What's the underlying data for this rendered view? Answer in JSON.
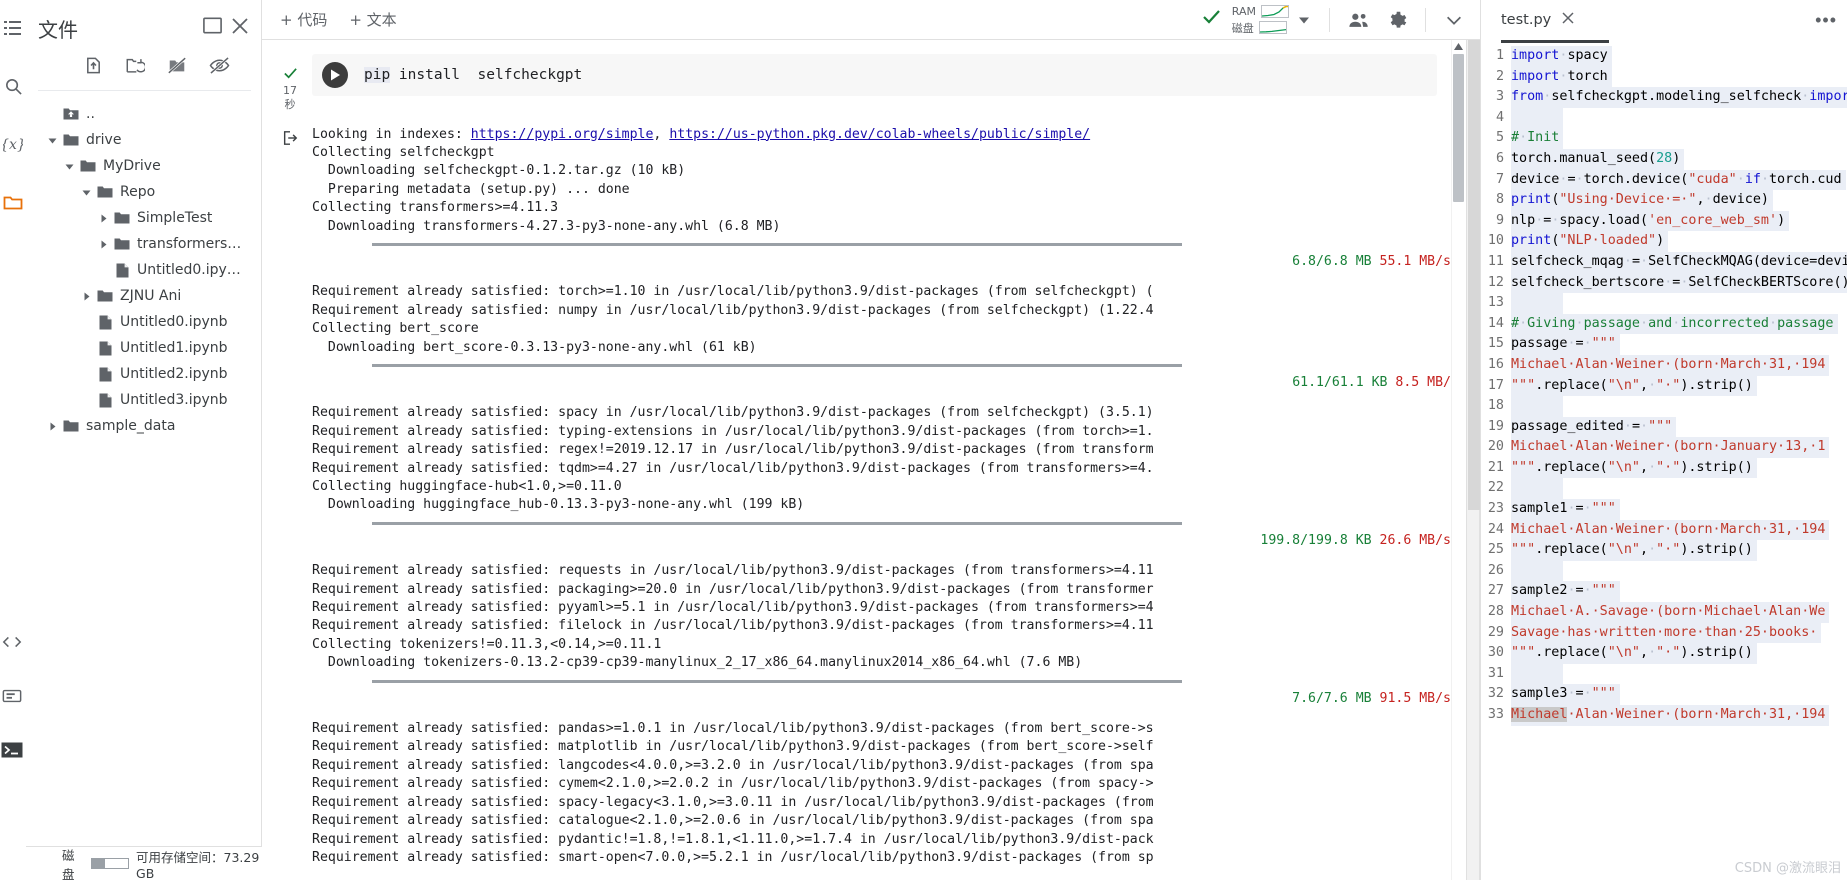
{
  "rail": {
    "top_icons": [
      "menu-icon",
      "search-icon",
      "variables-icon",
      "folder-icon"
    ],
    "bottom_icons": [
      "code-snippets-icon",
      "command-palette-icon",
      "terminal-icon"
    ]
  },
  "files": {
    "title": "文件",
    "header_icons": [
      "open-in-new-icon",
      "close-icon"
    ],
    "toolbar_icons": [
      "upload-icon",
      "refresh-folder-icon",
      "mount-drive-off-icon",
      "hide-hidden-icon"
    ],
    "tree": [
      {
        "label": "..",
        "depth": 0,
        "twisty": "",
        "icon": "folder-up-icon"
      },
      {
        "label": "drive",
        "depth": 0,
        "twisty": "down",
        "icon": "folder-icon"
      },
      {
        "label": "MyDrive",
        "depth": 1,
        "twisty": "down",
        "icon": "folder-icon"
      },
      {
        "label": "Repo",
        "depth": 2,
        "twisty": "down",
        "icon": "folder-icon"
      },
      {
        "label": "SimpleTest",
        "depth": 3,
        "twisty": "right",
        "icon": "folder-icon"
      },
      {
        "label": "transformers…",
        "depth": 3,
        "twisty": "right",
        "icon": "folder-icon"
      },
      {
        "label": "Untitled0.ipy…",
        "depth": 3,
        "twisty": "",
        "icon": "file-icon"
      },
      {
        "label": "ZJNU Ani",
        "depth": 2,
        "twisty": "right",
        "icon": "folder-icon"
      },
      {
        "label": "Untitled0.ipynb",
        "depth": 2,
        "twisty": "",
        "icon": "file-icon"
      },
      {
        "label": "Untitled1.ipynb",
        "depth": 2,
        "twisty": "",
        "icon": "file-icon"
      },
      {
        "label": "Untitled2.ipynb",
        "depth": 2,
        "twisty": "",
        "icon": "file-icon"
      },
      {
        "label": "Untitled3.ipynb",
        "depth": 2,
        "twisty": "",
        "icon": "file-icon"
      },
      {
        "label": "sample_data",
        "depth": 0,
        "twisty": "right",
        "icon": "folder-icon"
      }
    ],
    "disk": {
      "label": "磁盘",
      "gauge_percent": 38,
      "free_text": "可用存储空间：73.29 GB"
    }
  },
  "notebook": {
    "toolbar": {
      "add_code": "+ 代码",
      "add_text": "+ 文本",
      "connected_icon": "check-icon",
      "ram_label": "RAM",
      "disk_label": "磁盘",
      "dropdown_icon": "chevron-down-icon",
      "share_icon": "people-icon",
      "settings_icon": "gear-icon",
      "collapse_icon": "chevron-down-icon"
    },
    "cell": {
      "status_icon": "check-icon",
      "elapsed": "17",
      "elapsed_unit": "秒",
      "run_icon": "play-icon",
      "code_prefix": "pip",
      "code_rest": " install  selfcheckgpt",
      "output_icon": "output-arrow-icon"
    },
    "output_lines": [
      {
        "type": "link-line",
        "pre": "Looking in indexes: ",
        "links": [
          "https://pypi.org/simple",
          "https://us-python.pkg.dev/colab-wheels/public/simple/"
        ],
        "sep": ", "
      },
      {
        "type": "plain",
        "text": "Collecting selfcheckgpt"
      },
      {
        "type": "plain",
        "text": "  Downloading selfcheckgpt-0.1.2.tar.gz (10 kB)"
      },
      {
        "type": "plain",
        "text": "  Preparing metadata (setup.py) ... done"
      },
      {
        "type": "plain",
        "text": "Collecting transformers>=4.11.3"
      },
      {
        "type": "plain",
        "text": "  Downloading transformers-4.27.3-py3-none-any.whl (6.8 MB)"
      },
      {
        "type": "progress",
        "size_done": "6.8/6.8 MB",
        "speed": "55.1 MB/s"
      },
      {
        "type": "plain",
        "text": "Requirement already satisfied: torch>=1.10 in /usr/local/lib/python3.9/dist-packages (from selfcheckgpt) ("
      },
      {
        "type": "plain",
        "text": "Requirement already satisfied: numpy in /usr/local/lib/python3.9/dist-packages (from selfcheckgpt) (1.22.4"
      },
      {
        "type": "plain",
        "text": "Collecting bert_score"
      },
      {
        "type": "plain",
        "text": "  Downloading bert_score-0.3.13-py3-none-any.whl (61 kB)"
      },
      {
        "type": "progress",
        "size_done": "61.1/61.1 KB",
        "speed": "8.5 MB/"
      },
      {
        "type": "plain",
        "text": "Requirement already satisfied: spacy in /usr/local/lib/python3.9/dist-packages (from selfcheckgpt) (3.5.1)"
      },
      {
        "type": "plain",
        "text": "Requirement already satisfied: typing-extensions in /usr/local/lib/python3.9/dist-packages (from torch>=1."
      },
      {
        "type": "plain",
        "text": "Requirement already satisfied: regex!=2019.12.17 in /usr/local/lib/python3.9/dist-packages (from transform"
      },
      {
        "type": "plain",
        "text": "Requirement already satisfied: tqdm>=4.27 in /usr/local/lib/python3.9/dist-packages (from transformers>=4."
      },
      {
        "type": "plain",
        "text": "Collecting huggingface-hub<1.0,>=0.11.0"
      },
      {
        "type": "plain",
        "text": "  Downloading huggingface_hub-0.13.3-py3-none-any.whl (199 kB)"
      },
      {
        "type": "progress",
        "size_done": "199.8/199.8 KB",
        "speed": "26.6 MB/s"
      },
      {
        "type": "plain",
        "text": "Requirement already satisfied: requests in /usr/local/lib/python3.9/dist-packages (from transformers>=4.11"
      },
      {
        "type": "plain",
        "text": "Requirement already satisfied: packaging>=20.0 in /usr/local/lib/python3.9/dist-packages (from transformer"
      },
      {
        "type": "plain",
        "text": "Requirement already satisfied: pyyaml>=5.1 in /usr/local/lib/python3.9/dist-packages (from transformers>=4"
      },
      {
        "type": "plain",
        "text": "Requirement already satisfied: filelock in /usr/local/lib/python3.9/dist-packages (from transformers>=4.11"
      },
      {
        "type": "plain",
        "text": "Collecting tokenizers!=0.11.3,<0.14,>=0.11.1"
      },
      {
        "type": "plain",
        "text": "  Downloading tokenizers-0.13.2-cp39-cp39-manylinux_2_17_x86_64.manylinux2014_x86_64.whl (7.6 MB)"
      },
      {
        "type": "progress",
        "size_done": "7.6/7.6 MB",
        "speed": "91.5 MB/s"
      },
      {
        "type": "plain",
        "text": "Requirement already satisfied: pandas>=1.0.1 in /usr/local/lib/python3.9/dist-packages (from bert_score->s"
      },
      {
        "type": "plain",
        "text": "Requirement already satisfied: matplotlib in /usr/local/lib/python3.9/dist-packages (from bert_score->self"
      },
      {
        "type": "plain",
        "text": "Requirement already satisfied: langcodes<4.0.0,>=3.2.0 in /usr/local/lib/python3.9/dist-packages (from spa"
      },
      {
        "type": "plain",
        "text": "Requirement already satisfied: cymem<2.1.0,>=2.0.2 in /usr/local/lib/python3.9/dist-packages (from spacy->"
      },
      {
        "type": "plain",
        "text": "Requirement already satisfied: spacy-legacy<3.1.0,>=3.0.11 in /usr/local/lib/python3.9/dist-packages (from"
      },
      {
        "type": "plain",
        "text": "Requirement already satisfied: catalogue<2.1.0,>=2.0.6 in /usr/local/lib/python3.9/dist-packages (from spa"
      },
      {
        "type": "plain",
        "text": "Requirement already satisfied: pydantic!=1.8,!=1.8.1,<1.11.0,>=1.7.4 in /usr/local/lib/python3.9/dist-pack"
      },
      {
        "type": "plain",
        "text": "Requirement already satisfied: smart-open<7.0.0,>=5.2.1 in /usr/local/lib/python3.9/dist-packages (from sp"
      }
    ]
  },
  "editor": {
    "tab_name": "test.py",
    "close_icon": "close-icon",
    "more_icon": "more-options-icon",
    "lines": [
      {
        "n": 1,
        "segs": [
          {
            "t": "import",
            "c": "kw"
          },
          {
            "t": "·",
            "c": "dot"
          },
          {
            "t": "spacy",
            "c": ""
          }
        ]
      },
      {
        "n": 2,
        "segs": [
          {
            "t": "import",
            "c": "kw"
          },
          {
            "t": "·",
            "c": "dot"
          },
          {
            "t": "torch",
            "c": ""
          }
        ]
      },
      {
        "n": 3,
        "segs": [
          {
            "t": "from",
            "c": "kw"
          },
          {
            "t": "·",
            "c": "dot"
          },
          {
            "t": "selfcheckgpt.modeling_selfcheck",
            "c": ""
          },
          {
            "t": "·",
            "c": "dot"
          },
          {
            "t": "import",
            "c": "kw"
          }
        ]
      },
      {
        "n": 4,
        "segs": []
      },
      {
        "n": 5,
        "segs": [
          {
            "t": "#",
            "c": "cmt"
          },
          {
            "t": "·",
            "c": "dot"
          },
          {
            "t": "Init",
            "c": "cmt"
          }
        ]
      },
      {
        "n": 6,
        "segs": [
          {
            "t": "torch.manual_seed(",
            "c": ""
          },
          {
            "t": "28",
            "c": "num"
          },
          {
            "t": ")",
            "c": ""
          }
        ]
      },
      {
        "n": 7,
        "segs": [
          {
            "t": "device",
            "c": ""
          },
          {
            "t": "·",
            "c": "dot"
          },
          {
            "t": "=",
            "c": ""
          },
          {
            "t": "·",
            "c": "dot"
          },
          {
            "t": "torch.device(",
            "c": ""
          },
          {
            "t": "\"cuda\"",
            "c": "str"
          },
          {
            "t": "·",
            "c": "dot"
          },
          {
            "t": "if",
            "c": "kw"
          },
          {
            "t": "·",
            "c": "dot"
          },
          {
            "t": "torch.cud",
            "c": ""
          }
        ]
      },
      {
        "n": 8,
        "segs": [
          {
            "t": "print",
            "c": "kw"
          },
          {
            "t": "(",
            "c": ""
          },
          {
            "t": "\"Using·Device·=·\"",
            "c": "str"
          },
          {
            "t": ",",
            "c": ""
          },
          {
            "t": "·",
            "c": "dot"
          },
          {
            "t": "device)",
            "c": ""
          }
        ]
      },
      {
        "n": 9,
        "segs": [
          {
            "t": "nlp",
            "c": ""
          },
          {
            "t": "·",
            "c": "dot"
          },
          {
            "t": "=",
            "c": ""
          },
          {
            "t": "·",
            "c": "dot"
          },
          {
            "t": "spacy.load(",
            "c": ""
          },
          {
            "t": "'en_core_web_sm'",
            "c": "str"
          },
          {
            "t": ")",
            "c": ""
          }
        ]
      },
      {
        "n": 10,
        "segs": [
          {
            "t": "print",
            "c": "kw"
          },
          {
            "t": "(",
            "c": ""
          },
          {
            "t": "\"NLP·loaded\"",
            "c": "str"
          },
          {
            "t": ")",
            "c": ""
          }
        ]
      },
      {
        "n": 11,
        "segs": [
          {
            "t": "selfcheck_mqag",
            "c": ""
          },
          {
            "t": "·",
            "c": "dot"
          },
          {
            "t": "=",
            "c": ""
          },
          {
            "t": "·",
            "c": "dot"
          },
          {
            "t": "SelfCheckMQAG(device=devic",
            "c": ""
          }
        ]
      },
      {
        "n": 12,
        "segs": [
          {
            "t": "selfcheck_bertscore",
            "c": ""
          },
          {
            "t": "·",
            "c": "dot"
          },
          {
            "t": "=",
            "c": ""
          },
          {
            "t": "·",
            "c": "dot"
          },
          {
            "t": "SelfCheckBERTScore()",
            "c": ""
          }
        ]
      },
      {
        "n": 13,
        "segs": []
      },
      {
        "n": 14,
        "segs": [
          {
            "t": "#",
            "c": "cmt"
          },
          {
            "t": "·",
            "c": "dot"
          },
          {
            "t": "Giving",
            "c": "cmt"
          },
          {
            "t": "·",
            "c": "dot"
          },
          {
            "t": "passage",
            "c": "cmt"
          },
          {
            "t": "·",
            "c": "dot"
          },
          {
            "t": "and",
            "c": "cmt"
          },
          {
            "t": "·",
            "c": "dot"
          },
          {
            "t": "incorrected",
            "c": "cmt"
          },
          {
            "t": "·",
            "c": "dot"
          },
          {
            "t": "passage",
            "c": "cmt"
          }
        ]
      },
      {
        "n": 15,
        "segs": [
          {
            "t": "passage",
            "c": ""
          },
          {
            "t": "·",
            "c": "dot"
          },
          {
            "t": "=",
            "c": ""
          },
          {
            "t": "·",
            "c": "dot"
          },
          {
            "t": "\"\"\"",
            "c": "str"
          }
        ]
      },
      {
        "n": 16,
        "segs": [
          {
            "t": "Michael·Alan·Weiner·(born·March·31,·194",
            "c": "str"
          }
        ]
      },
      {
        "n": 17,
        "segs": [
          {
            "t": "\"\"\"",
            "c": "str"
          },
          {
            "t": ".replace(",
            "c": ""
          },
          {
            "t": "\"\\n\"",
            "c": "str"
          },
          {
            "t": ",",
            "c": ""
          },
          {
            "t": "·",
            "c": "dot"
          },
          {
            "t": "\"·\"",
            "c": "str"
          },
          {
            "t": ").strip()",
            "c": ""
          }
        ]
      },
      {
        "n": 18,
        "segs": []
      },
      {
        "n": 19,
        "segs": [
          {
            "t": "passage_edited",
            "c": ""
          },
          {
            "t": "·",
            "c": "dot"
          },
          {
            "t": "=",
            "c": ""
          },
          {
            "t": "·",
            "c": "dot"
          },
          {
            "t": "\"\"\"",
            "c": "str"
          }
        ]
      },
      {
        "n": 20,
        "segs": [
          {
            "t": "Michael·Alan·Weiner·(born·January·13,·1",
            "c": "str"
          }
        ]
      },
      {
        "n": 21,
        "segs": [
          {
            "t": "\"\"\"",
            "c": "str"
          },
          {
            "t": ".replace(",
            "c": ""
          },
          {
            "t": "\"\\n\"",
            "c": "str"
          },
          {
            "t": ",",
            "c": ""
          },
          {
            "t": "·",
            "c": "dot"
          },
          {
            "t": "\"·\"",
            "c": "str"
          },
          {
            "t": ").strip()",
            "c": ""
          }
        ]
      },
      {
        "n": 22,
        "segs": []
      },
      {
        "n": 23,
        "segs": [
          {
            "t": "sample1",
            "c": ""
          },
          {
            "t": "·",
            "c": "dot"
          },
          {
            "t": "=",
            "c": ""
          },
          {
            "t": "·",
            "c": "dot"
          },
          {
            "t": "\"\"\"",
            "c": "str"
          }
        ]
      },
      {
        "n": 24,
        "segs": [
          {
            "t": "Michael·Alan·Weiner·(born·March·31,·194",
            "c": "str"
          }
        ]
      },
      {
        "n": 25,
        "segs": [
          {
            "t": "\"\"\"",
            "c": "str"
          },
          {
            "t": ".replace(",
            "c": ""
          },
          {
            "t": "\"\\n\"",
            "c": "str"
          },
          {
            "t": ",",
            "c": ""
          },
          {
            "t": "·",
            "c": "dot"
          },
          {
            "t": "\"·\"",
            "c": "str"
          },
          {
            "t": ").strip()",
            "c": ""
          }
        ]
      },
      {
        "n": 26,
        "segs": []
      },
      {
        "n": 27,
        "segs": [
          {
            "t": "sample2",
            "c": ""
          },
          {
            "t": "·",
            "c": "dot"
          },
          {
            "t": "=",
            "c": ""
          },
          {
            "t": "·",
            "c": "dot"
          },
          {
            "t": "\"\"\"",
            "c": "str"
          }
        ]
      },
      {
        "n": 28,
        "segs": [
          {
            "t": "Michael·A.·Savage·(born·Michael·Alan·We",
            "c": "str"
          }
        ]
      },
      {
        "n": 29,
        "segs": [
          {
            "t": "Savage·has·written·more·than·25·books·",
            "c": "str"
          }
        ]
      },
      {
        "n": 30,
        "segs": [
          {
            "t": "\"\"\"",
            "c": "str"
          },
          {
            "t": ".replace(",
            "c": ""
          },
          {
            "t": "\"\\n\"",
            "c": "str"
          },
          {
            "t": ",",
            "c": ""
          },
          {
            "t": "·",
            "c": "dot"
          },
          {
            "t": "\"·\"",
            "c": "str"
          },
          {
            "t": ").strip()",
            "c": ""
          }
        ]
      },
      {
        "n": 31,
        "segs": []
      },
      {
        "n": 32,
        "segs": [
          {
            "t": "sample3",
            "c": ""
          },
          {
            "t": "·",
            "c": "dot"
          },
          {
            "t": "=",
            "c": ""
          },
          {
            "t": "·",
            "c": "dot"
          },
          {
            "t": "\"\"\"",
            "c": "str"
          }
        ]
      },
      {
        "n": 33,
        "segs": [
          {
            "t": "Michael",
            "c": "str sel"
          },
          {
            "t": "·Alan·Weiner·(born·March·31,·194",
            "c": "str"
          }
        ]
      }
    ]
  },
  "watermark": "CSDN @激流眼泪"
}
